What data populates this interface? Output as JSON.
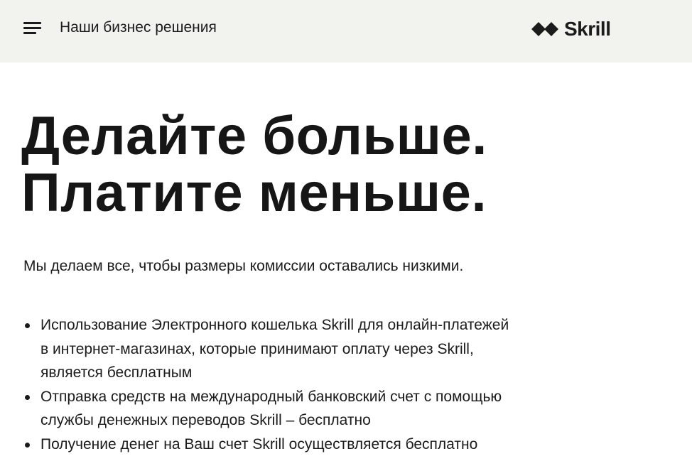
{
  "header": {
    "menu_icon": "hamburger-menu-icon",
    "title": "Наши бизнес решения",
    "logo_text": "Skrill",
    "logo_icon": "skrill-diamond-arrow-icon"
  },
  "hero": {
    "title_line1": "Делайте больше.",
    "title_line2": "Платите меньше.",
    "lead": "Мы делаем все, чтобы размеры комиссии оставались низкими."
  },
  "features": [
    {
      "text": "Использование Электронного кошелька Skrill для онлайн-платежей в интернет-магазинах, которые принимают оплату через Skrill, является бесплатным"
    },
    {
      "text": "Отправка средств на международный банковский счет с помощью службы денежных переводов Skrill – бесплатно"
    },
    {
      "text": "Получение денег на Ваш счет Skrill осуществляется бесплатно"
    }
  ],
  "colors": {
    "header_background": "#f2f2ee",
    "text": "#1b1b1b",
    "page_background": "#ffffff"
  }
}
